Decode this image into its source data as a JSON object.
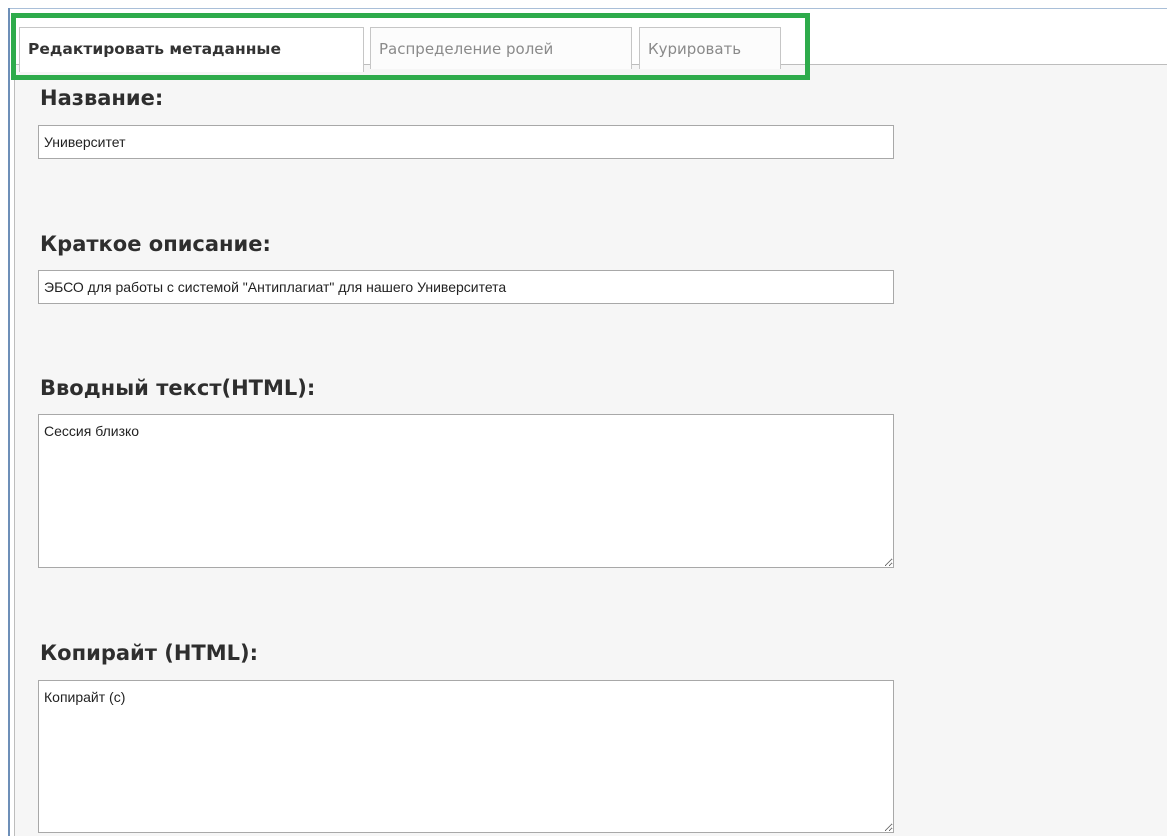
{
  "tabs": [
    {
      "label": "Редактировать метаданные",
      "active": true
    },
    {
      "label": "Распределение ролей",
      "active": false
    },
    {
      "label": "Курировать",
      "active": false
    }
  ],
  "form": {
    "name": {
      "label": "Название:",
      "value": "Университет"
    },
    "short_description": {
      "label": "Краткое описание:",
      "value": "ЭБСО для работы с системой \"Антиплагиат\" для нашего Университета"
    },
    "intro_text": {
      "label": "Вводный текст(HTML):",
      "value": "Сессия близко"
    },
    "copyright": {
      "label": "Копирайт (HTML):",
      "value": "Копирайт (с)"
    }
  },
  "colors": {
    "highlight": "#2eab4b",
    "panel_background": "#f6f6f6",
    "frame": "#6d8fb8"
  }
}
